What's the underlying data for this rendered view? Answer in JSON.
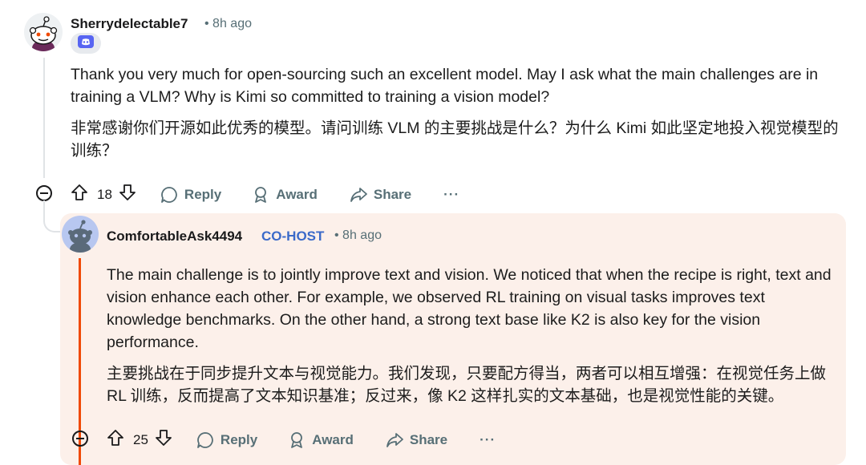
{
  "comment": {
    "username": "Sherrydelectable7",
    "time": "8h ago",
    "flair_icon": "discord-icon",
    "paragraphs": [
      "Thank you very much for open-sourcing such an excellent model. May I ask what the main challenges are in training a VLM? Why is Kimi so committed to training a vision model?",
      "非常感谢你们开源如此优秀的模型。请问训练 VLM 的主要挑战是什么？为什么 Kimi 如此坚定地投入视觉模型的训练？"
    ],
    "votes": "18",
    "actions": {
      "reply": "Reply",
      "award": "Award",
      "share": "Share",
      "more": "···"
    }
  },
  "reply": {
    "username": "ComfortableAsk4494",
    "badge": "CO-HOST",
    "time": "8h ago",
    "paragraphs": [
      "The main challenge is to jointly improve text and vision. We noticed that when the recipe is right, text and vision enhance each other. For example, we observed RL training on visual tasks improves text knowledge benchmarks. On the other hand, a strong text base like K2 is also key for the vision performance.",
      "主要挑战在于同步提升文本与视觉能力。我们发现，只要配方得当，两者可以相互增强：在视觉任务上做 RL 训练，反而提高了文本知识基准；反过来，像 K2 这样扎实的文本基础，也是视觉性能的关键。"
    ],
    "votes": "25",
    "actions": {
      "reply": "Reply",
      "award": "Award",
      "share": "Share",
      "more": "···"
    }
  },
  "colors": {
    "meta": "#576f76",
    "cohost": "#3b6ac9",
    "reply_bg": "#fcf0ea",
    "thread_accent": "#f04a06"
  }
}
